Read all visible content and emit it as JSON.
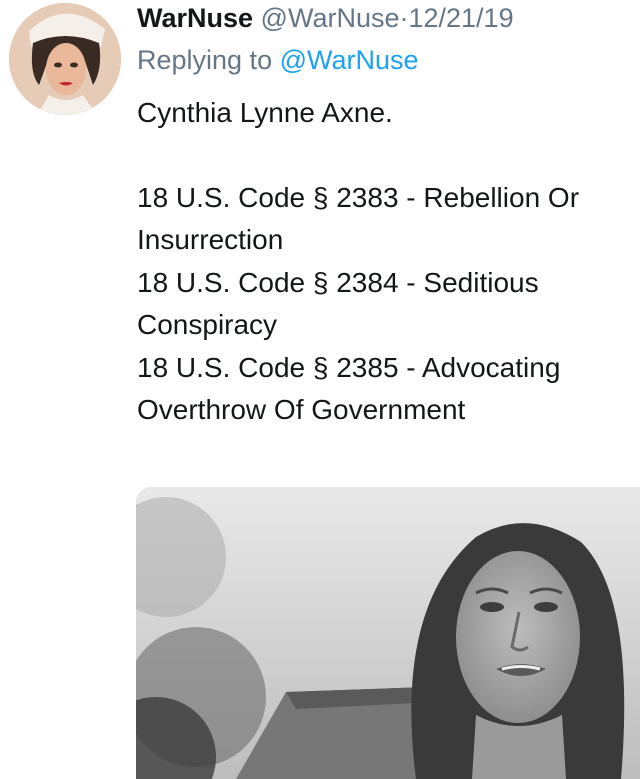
{
  "tweet": {
    "author_name": "WarNuse",
    "author_handle": "@WarNuse",
    "separator": "·",
    "date": "12/21/19",
    "replying_prefix": "Replying to",
    "replying_handle": "@WarNuse",
    "lines": [
      "Cynthia Lynne Axne.",
      "18 U.S. Code § 2383 - Rebellion Or Insurrection",
      "18 U.S. Code § 2384 - Seditious Conspiracy",
      "18 U.S. Code § 2385 - Advocating Overthrow Of Government"
    ]
  },
  "icons": {
    "avatar": "vintage-nurse-portrait",
    "media": "black-and-white-photo-woman"
  }
}
